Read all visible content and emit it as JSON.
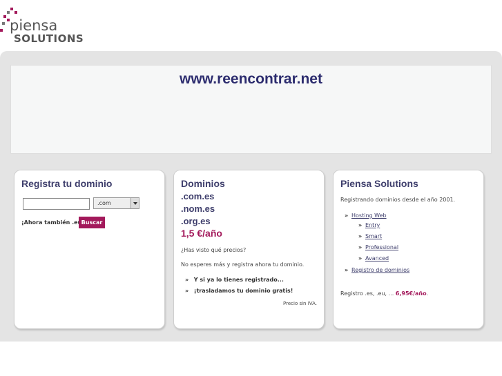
{
  "logo": {
    "word1": "piensa",
    "word2": "SOLUTIONS"
  },
  "banner": {
    "title": "www.reencontrar.net"
  },
  "register": {
    "title": "Registra tu dominio",
    "input_value": "",
    "tld_selected": ".com",
    "eu_text": "¡Ahora también .eu!",
    "search_button": "Buscar"
  },
  "domains": {
    "title": "Dominios",
    "tlds": [
      ".com.es",
      ".nom.es",
      ".org.es"
    ],
    "price": "1,5 €/año",
    "question": "¿Has visto qué precios?",
    "cta": "No esperes más y registra ahora tu dominio.",
    "items": [
      "Y si ya lo tienes registrado...",
      "¡trasladamos tu dominio gratis!"
    ],
    "note": "Precio sin IVA."
  },
  "company": {
    "title": "Piensa Solutions",
    "since": "Registrando dominios desde el año 2001.",
    "hosting": "Hosting Web",
    "plans": [
      "Entry",
      "Smart",
      "Professional",
      "Avanced"
    ],
    "domains_link": "Registro de dominios",
    "reg_prefix": "Registro .es, .eu, ... ",
    "reg_price": "6,95€/año",
    "reg_suffix": "."
  },
  "colors": {
    "accent": "#a3195b",
    "heading": "#3d3d6b",
    "banner_title": "#2c2c6e",
    "background_band": "#e4e4e4"
  },
  "icons": {
    "bullet": "double-chevron-icon",
    "dropdown": "chevron-down-icon"
  }
}
